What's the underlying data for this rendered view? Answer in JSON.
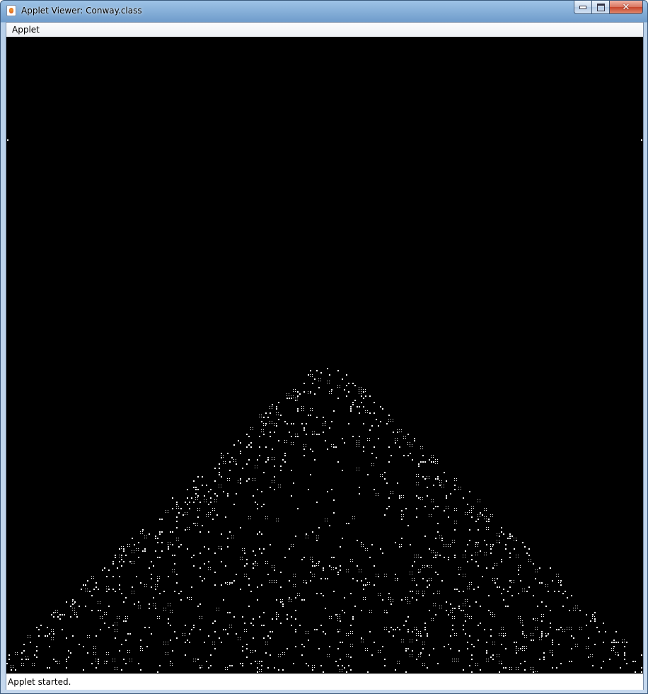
{
  "window": {
    "title": "Applet Viewer: Conway.class",
    "controls": [
      "minimize-icon",
      "maximize-icon",
      "close-icon"
    ]
  },
  "menubar": {
    "items": [
      {
        "label": "Applet"
      }
    ]
  },
  "canvas": {
    "background": "#000000",
    "cell_color": "#ffffff",
    "content": "Conway's Game of Life pattern"
  },
  "status": {
    "text": "Applet started."
  }
}
